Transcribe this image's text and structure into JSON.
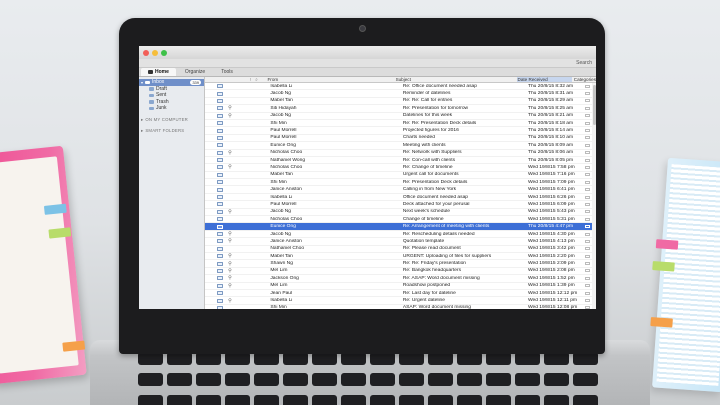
{
  "app": {
    "toolbar": {
      "search_label": "Search"
    },
    "tabs": [
      {
        "label": "Home",
        "icon": "home-icon"
      },
      {
        "label": "Organize"
      },
      {
        "label": "Tools"
      }
    ],
    "sidebar": {
      "items": [
        {
          "label": "Inbox",
          "count": "339",
          "selected": true
        },
        {
          "label": "Draft"
        },
        {
          "label": "Sent"
        },
        {
          "label": "Trash"
        },
        {
          "label": "Junk"
        }
      ],
      "sections": [
        "ON MY COMPUTER",
        "SMART FOLDERS"
      ]
    },
    "columns": {
      "from": "From",
      "subject": "Subject",
      "date": "Date Received",
      "categories": "Categories"
    },
    "messages": [
      {
        "from": "Isabella Li",
        "subject": "Re: Office document needed asap",
        "date": "Thu 20/8/15 8:32 am",
        "attach": false
      },
      {
        "from": "Jacob Ng",
        "subject": "Reminder of datelines",
        "date": "Thu 20/8/15 8:31 am",
        "attach": false
      },
      {
        "from": "Mabel Tan",
        "subject": "Re: Re: Call for entries",
        "date": "Thu 20/8/15 8:29 am",
        "attach": false
      },
      {
        "from": "Siti Hidayah",
        "subject": "Re: Presentation for tomorrow",
        "date": "Thu 20/8/15 8:25 am",
        "attach": true
      },
      {
        "from": "Jacob Ng",
        "subject": "Datelines for this week",
        "date": "Thu 20/8/15 8:21 am",
        "attach": true
      },
      {
        "from": "Shi Min",
        "subject": "Re: Re: Presentation Deck details",
        "date": "Thu 20/8/15 8:18 am",
        "attach": false
      },
      {
        "from": "Paul Morrell",
        "subject": "Projected figures for 2016",
        "date": "Thu 20/8/15 8:14 am",
        "attach": false
      },
      {
        "from": "Paul Morrell",
        "subject": "Charts needed",
        "date": "Thu 20/8/15 8:10 am",
        "attach": false
      },
      {
        "from": "Eunice Ong",
        "subject": "Meeting with clients",
        "date": "Thu 20/8/15 8:09 am",
        "attach": false
      },
      {
        "from": "Nicholas Choo",
        "subject": "Re: Network with Suppliers",
        "date": "Thu 20/8/15 8:06 am",
        "attach": true
      },
      {
        "from": "Nathaniel Wong",
        "subject": "Re: Con-call with clients",
        "date": "Thu 20/8/15 8:05 pm",
        "attach": false
      },
      {
        "from": "Nicholas Choo",
        "subject": "Re: Change of timeline",
        "date": "Wed 19/8/15 7:58 pm",
        "attach": true
      },
      {
        "from": "Mabel Tan",
        "subject": "Urgent call for documents",
        "date": "Wed 19/8/15 7:16 pm",
        "attach": false
      },
      {
        "from": "Shi Min",
        "subject": "Re: Presentation Deck details",
        "date": "Wed 19/8/15 7:09 pm",
        "attach": false
      },
      {
        "from": "Janice Aniston",
        "subject": "Calling in from New York",
        "date": "Wed 19/8/15 6:41 pm",
        "attach": false
      },
      {
        "from": "Isabella Li",
        "subject": "Office document needed asap",
        "date": "Wed 19/8/15 6:26 pm",
        "attach": false
      },
      {
        "from": "Paul Morrell",
        "subject": "Deck attached for your perusal",
        "date": "Wed 19/8/15 6:09 pm",
        "attach": false
      },
      {
        "from": "Jacob Ng",
        "subject": "Next week's schedule",
        "date": "Wed 19/8/15 5:43 pm",
        "attach": true
      },
      {
        "from": "Nicholas Choo",
        "subject": "Change of timeline",
        "date": "Wed 19/8/15 5:31 pm",
        "attach": false
      },
      {
        "from": "Eunice Ong",
        "subject": "Re: Arrangement of meeting with clients",
        "date": "Thu 20/8/15 4:47 pm",
        "attach": false,
        "selected": true
      },
      {
        "from": "Jacob Ng",
        "subject": "Re: Rescheduling details needed",
        "date": "Wed 19/8/15 4:30 pm",
        "attach": true
      },
      {
        "from": "Janice Aniston",
        "subject": "Quotation template",
        "date": "Wed 19/8/15 4:13 pm",
        "attach": true
      },
      {
        "from": "Nathaniel Choo",
        "subject": "Re: Please read document",
        "date": "Wed 19/8/15 3:42 pm",
        "attach": false
      },
      {
        "from": "Mabel Tan",
        "subject": "URGENT: Uploading of files for suppliers",
        "date": "Wed 19/8/15 2:20 pm",
        "attach": true
      },
      {
        "from": "Shawn Ng",
        "subject": "Re: Re: Friday's presentation",
        "date": "Wed 19/8/15 2:09 pm",
        "attach": true
      },
      {
        "from": "Mel Lim",
        "subject": "Re: Bangkok headquarters",
        "date": "Wed 19/8/15 2:08 pm",
        "attach": true
      },
      {
        "from": "Jackson Ong",
        "subject": "Re: ASAP: Word document missing",
        "date": "Wed 19/8/15 1:52 pm",
        "attach": true
      },
      {
        "from": "Mel Lim",
        "subject": "Roadshow postponed",
        "date": "Wed 19/8/15 1:39 pm",
        "attach": true
      },
      {
        "from": "Jean Paul",
        "subject": "Re: Last day for dateline",
        "date": "Wed 19/8/15 12:12 pm",
        "attach": false
      },
      {
        "from": "Isabella Li",
        "subject": "Re: Urgent dateline",
        "date": "Wed 19/8/15 12:11 pm",
        "attach": true
      },
      {
        "from": "Shi Min",
        "subject": "ASAP: Word document missing",
        "date": "Wed 19/8/15 12:08 pm",
        "attach": false
      }
    ]
  },
  "colors": {
    "selection": "#3d6fd6",
    "sidebar_selected": "#6f8fc9",
    "folder_pink": "#ee4f93",
    "folder_blue": "#c7e6f7"
  }
}
